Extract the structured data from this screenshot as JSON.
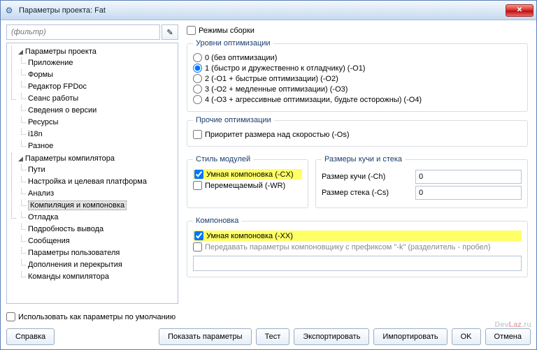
{
  "title": "Параметры проекта: Fat",
  "filter": {
    "placeholder": "(фильтр)"
  },
  "tree": {
    "g1": {
      "label": "Параметры проекта",
      "items": [
        "Приложение",
        "Формы",
        "Редактор FPDoc",
        "Сеанс работы",
        "Сведения о версии",
        "Ресурсы",
        "i18n",
        "Разное"
      ]
    },
    "g2": {
      "label": "Параметры компилятора",
      "items": [
        "Пути",
        "Настройка и целевая платформа",
        "Анализ",
        "Компиляция и компоновка",
        "Отладка",
        "Подробность вывода",
        "Сообщения",
        "Параметры пользователя",
        "Дополнения и перекрытия",
        "Команды компилятора"
      ]
    }
  },
  "build_modes": "Режимы сборки",
  "opt": {
    "legend": "Уровни оптимизации",
    "r0": "0 (без оптимизации)",
    "r1": "1 (быстро и дружественно к отладчику) (-O1)",
    "r2": "2 (-O1 + быстрые оптимизации) (-O2)",
    "r3": "3 (-O2 + медленные оптимизации) (-O3)",
    "r4": "4 (-O3 + агрессивные оптимизации, будьте осторожны) (-O4)"
  },
  "other": {
    "legend": "Прочие оптимизации",
    "size": "Приоритет размера над скоростью (-Os)"
  },
  "unit": {
    "legend": "Стиль модулей",
    "smart": "Умная компоновка (-CX)",
    "reloc": "Перемещаемый (-WR)"
  },
  "heap": {
    "legend": "Размеры кучи и стека",
    "hlabel": "Размер кучи (-Ch)",
    "slabel": "Размер стека (-Cs)",
    "hval": "0",
    "sval": "0"
  },
  "link": {
    "legend": "Компоновка",
    "smart": "Умная компоновка (-XX)",
    "pass": "Передавать параметры компоновщику с префиксом \"-k\" (разделитель - пробел)"
  },
  "def": "Использовать как параметры по умолчанию",
  "btns": {
    "help": "Справка",
    "show": "Показать параметры",
    "test": "Тест",
    "export": "Экспортировать",
    "import": "Импортировать",
    "ok": "OK",
    "cancel": "Отмена"
  },
  "wm": {
    "a": "Dev",
    "b": "Laz",
    "c": ".ru"
  }
}
